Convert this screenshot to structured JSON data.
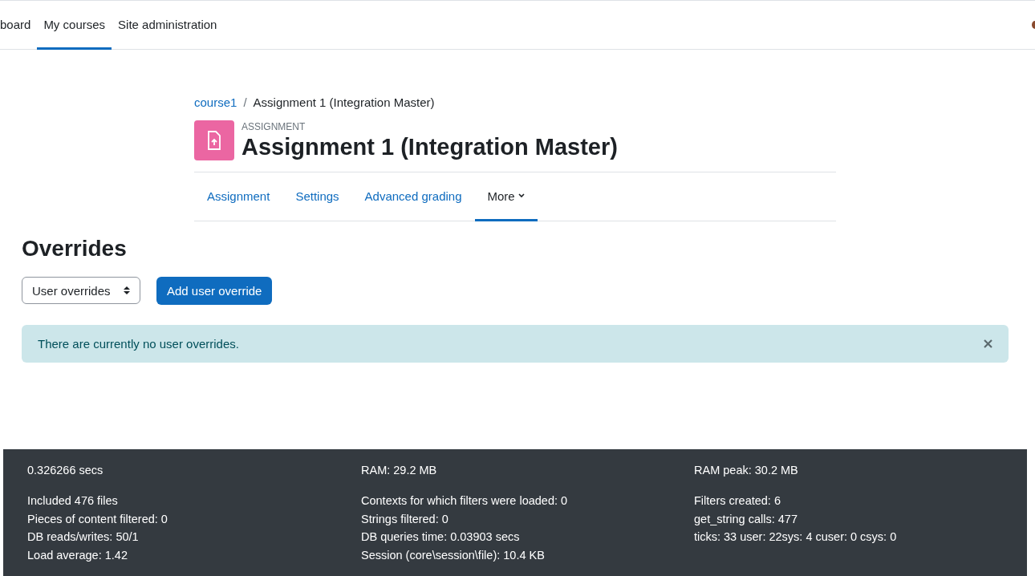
{
  "navbar": {
    "items": [
      {
        "label": "board",
        "selected": false
      },
      {
        "label": "My courses",
        "selected": true
      },
      {
        "label": "Site administration",
        "selected": false
      }
    ]
  },
  "breadcrumb": {
    "separator": "/",
    "items": [
      {
        "label": "course1",
        "link": true
      },
      {
        "label": "Assignment 1 (Integration Master)",
        "link": false
      }
    ]
  },
  "header": {
    "module_type": "ASSIGNMENT",
    "title": "Assignment 1 (Integration Master)"
  },
  "secondary_nav": [
    {
      "label": "Assignment",
      "selected": false,
      "dropdown": false
    },
    {
      "label": "Settings",
      "selected": false,
      "dropdown": false
    },
    {
      "label": "Advanced grading",
      "selected": false,
      "dropdown": false
    },
    {
      "label": "More",
      "selected": true,
      "dropdown": true
    }
  ],
  "page_title": "Overrides",
  "override_select": {
    "value": "User overrides"
  },
  "add_button": "Add user override",
  "alert": {
    "message": "There are currently no user overrides.",
    "dismissible": true
  },
  "footer": {
    "columns": [
      {
        "summary": "0.326266 secs",
        "lines": [
          "Included 476 files",
          "Pieces of content filtered: 0",
          "DB reads/writes: 50/1",
          "Load average: 1.42"
        ]
      },
      {
        "summary": "RAM: 29.2 MB",
        "lines": [
          "Contexts for which filters were loaded: 0",
          "Strings filtered: 0",
          "DB queries time: 0.03903 secs",
          "Session (core\\session\\file): 10.4 KB"
        ]
      },
      {
        "summary": "RAM peak: 30.2 MB",
        "lines": [
          "Filters created: 6",
          "get_string calls: 477",
          "ticks: 33 user: 22sys: 4 cuser: 0 csys: 0"
        ]
      }
    ]
  }
}
